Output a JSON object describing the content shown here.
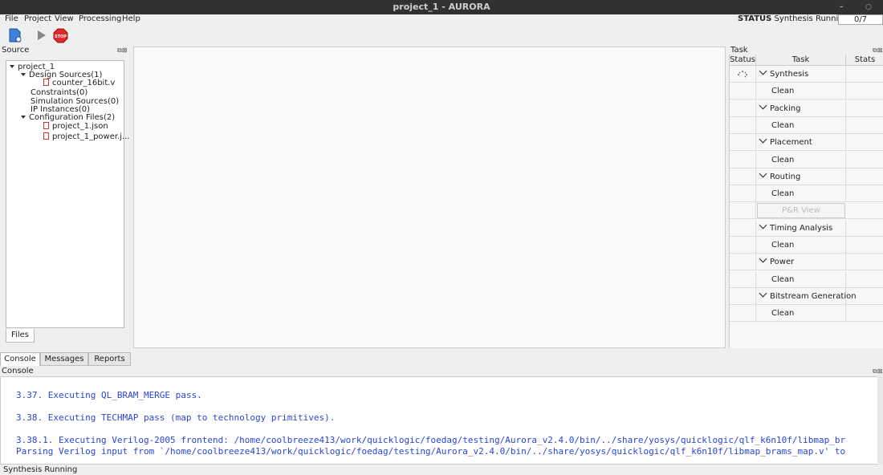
{
  "window": {
    "title": "project_1 - AURORA",
    "minimize": "–",
    "close": "○"
  },
  "menu": [
    "File",
    "Project",
    "View",
    "Processing",
    "Help"
  ],
  "status": {
    "label": "STATUS",
    "text": "Synthesis Running",
    "count": "0/7"
  },
  "toolbar": {
    "stop_label": "STOP"
  },
  "source_panel": {
    "title": "Source",
    "tree": {
      "root": "project_1",
      "design_sources": "Design Sources(1)",
      "design_file": "counter_16bit.v",
      "constraints": "Constraints(0)",
      "simulation_sources": "Simulation Sources(0)",
      "ip_instances": "IP Instances(0)",
      "configuration_files": "Configuration Files(2)",
      "config_file_1": "project_1.json",
      "config_file_2": "project_1_power.j..."
    },
    "tab": "Files"
  },
  "task_panel": {
    "title": "Task",
    "headers": {
      "status": "Status",
      "task": "Task",
      "stats": "Stats"
    },
    "rows": [
      {
        "label": "Synthesis",
        "type": "group"
      },
      {
        "label": "Clean",
        "type": "clean"
      },
      {
        "label": "Packing",
        "type": "group"
      },
      {
        "label": "Clean",
        "type": "clean"
      },
      {
        "label": "Placement",
        "type": "group"
      },
      {
        "label": "Clean",
        "type": "clean"
      },
      {
        "label": "Routing",
        "type": "group"
      },
      {
        "label": "Clean",
        "type": "clean"
      },
      {
        "label": "P&R View",
        "type": "button"
      },
      {
        "label": "Timing Analysis",
        "type": "group"
      },
      {
        "label": "Clean",
        "type": "clean"
      },
      {
        "label": "Power",
        "type": "group"
      },
      {
        "label": "Clean",
        "type": "clean"
      },
      {
        "label": "Bitstream Generation",
        "type": "group"
      },
      {
        "label": "Clean",
        "type": "clean"
      }
    ]
  },
  "bottom_tabs": [
    "Console",
    "Messages",
    "Reports"
  ],
  "console": {
    "title": "Console",
    "lines": [
      "3.37. Executing QL_BRAM_MERGE pass.",
      "3.38. Executing TECHMAP pass (map to technology primitives).",
      "3.38.1. Executing Verilog-2005 frontend: /home/coolbreeze413/work/quicklogic/foedag/testing/Aurora_v2.4.0/bin/../share/yosys/quicklogic/qlf_k6n10f/libmap_br",
      "Parsing Verilog input from `/home/coolbreeze413/work/quicklogic/foedag/testing/Aurora_v2.4.0/bin/../share/yosys/quicklogic/qlf_k6n10f/libmap_brams_map.v' to"
    ]
  },
  "statusbar": {
    "text": "Synthesis Running"
  }
}
